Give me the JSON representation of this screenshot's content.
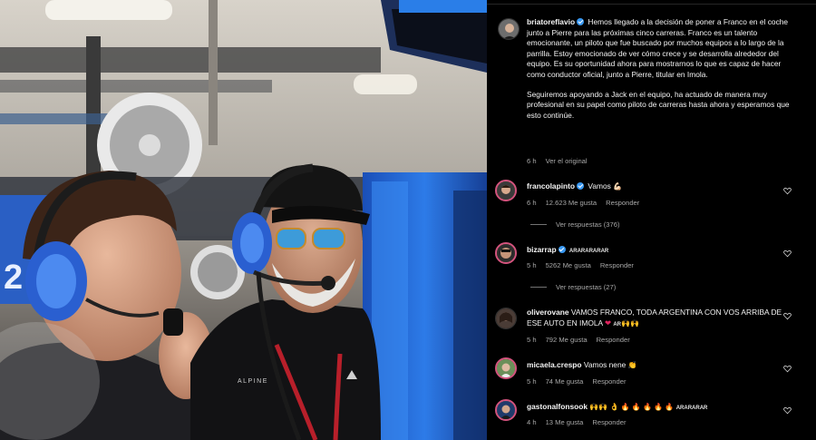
{
  "post": {
    "author": "briatoreflavio",
    "caption_p1": "Hemos llegado a la decisión de poner a Franco en el coche junto a Pierre para las próximas cinco carreras. Franco es un talento emocionante, un piloto que fue buscado por muchos equipos a lo largo de la parrilla. Estoy emocionado de ver cómo crece y se desarrolla alrededor del equipo. Es su oportunidad ahora para mostrarnos lo que es capaz de hacer como conductor oficial, junto a Pierre, titular en Imola.",
    "caption_p2": "Seguiremos apoyando a Jack en el equipo, ha actuado de manera muy profesional en su papel como piloto de carreras hasta ahora y esperamos que esto continúe.",
    "time": "6 h",
    "see_original": "Ver el original"
  },
  "comments": [
    {
      "user": "francolapinto",
      "verified": true,
      "text": "Vamos",
      "emoji": "💪🏻",
      "time": "6 h",
      "likes": "12.623 Me gusta",
      "reply": "Responder",
      "replies": "Ver respuestas (376)"
    },
    {
      "user": "bizarrap",
      "verified": true,
      "text": "ARARARARAR",
      "time": "5 h",
      "likes": "5262 Me gusta",
      "reply": "Responder",
      "replies": "Ver respuestas (27)"
    },
    {
      "user": "oliverovane",
      "verified": false,
      "text": "VAMOS FRANCO, TODA ARGENTINA CON VOS ARRIBA DE ESE AUTO EN IMOLA",
      "emoji": "❤",
      "tag": "AR",
      "emoji2": "🙌🙌",
      "time": "5 h",
      "likes": "792 Me gusta",
      "reply": "Responder"
    },
    {
      "user": "micaela.crespo",
      "verified": false,
      "text": "Vamos nene",
      "emoji": "👏",
      "time": "5 h",
      "likes": "74 Me gusta",
      "reply": "Responder"
    },
    {
      "user": "gastonalfonsook",
      "verified": false,
      "text": "🙌🙌 👌 🔥 🔥 🔥 🔥 🔥",
      "tag": "ARARARAR",
      "time": "4 h",
      "likes": "13 Me gusta",
      "reply": "Responder"
    }
  ],
  "photo": {
    "shirt_brand": "ALPINE",
    "car_number": "2"
  },
  "colors": {
    "verified": "#3897f0",
    "alpine_blue": "#1a5fd0",
    "heart": "#e0245e"
  },
  "icons": [
    "verified-badge-icon",
    "heart-icon"
  ]
}
